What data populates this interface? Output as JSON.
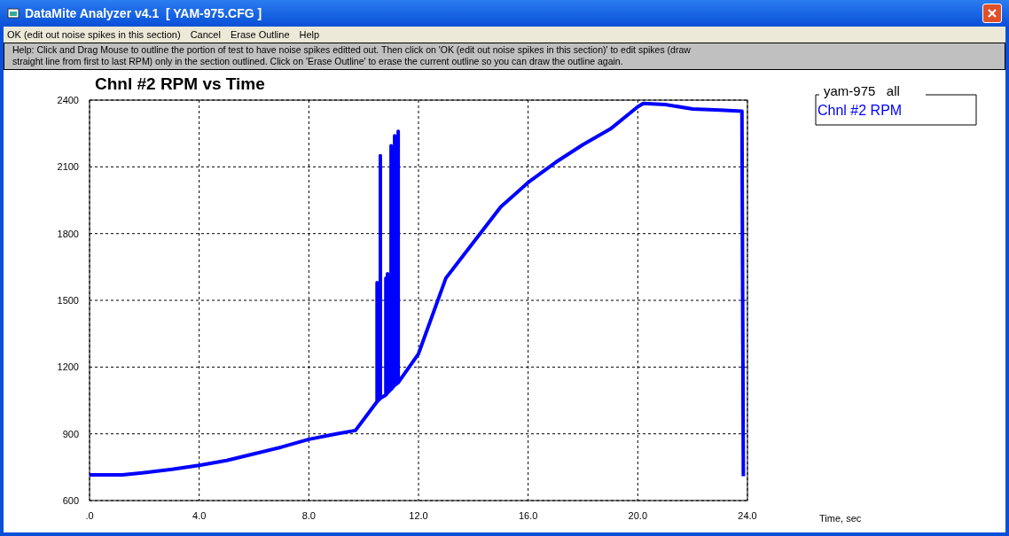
{
  "window": {
    "title": "DataMite Analyzer v4.1  [ YAM-975.CFG ]"
  },
  "menu": [
    "OK (edit out noise spikes in this section)",
    "Cancel",
    "Erase Outline",
    "Help"
  ],
  "help_text": "Help:  Click and Drag Mouse to outline the portion of test to have noise spikes editted out.  Then click on 'OK (edit out noise spikes in this section)' to edit spikes (draw straight line from first to last RPM) only in the section outlined.  Click on 'Erase Outline' to erase the current outline so you can draw the outline again.",
  "legend": {
    "title": "yam-975   all"
  },
  "chart_data": {
    "type": "line",
    "title": "Chnl #2 RPM vs Time",
    "grid": true,
    "x": [
      0,
      1.2,
      2,
      3,
      4,
      5,
      6,
      7,
      8,
      9,
      9.7,
      10.49,
      10.49,
      10.49,
      10.61,
      10.61,
      10.61,
      10.81,
      10.81,
      10.81,
      10.87,
      10.87,
      10.87,
      11.0,
      11.0,
      11.0,
      11.07,
      11.07,
      11.07,
      11.13,
      11.13,
      11.13,
      11.26,
      11.26,
      11.26,
      12,
      13,
      14,
      15,
      16,
      17,
      18,
      19,
      20,
      20.2,
      21,
      22,
      23,
      23.8,
      23.85
    ],
    "series": [
      {
        "name": "Chnl #2 RPM",
        "color": "#0000ff",
        "values": [
          715,
          715,
          725,
          740,
          758,
          780,
          810,
          840,
          875,
          900,
          915,
          1045,
          1580,
          1045,
          1060,
          2150,
          1060,
          1075,
          1600,
          1075,
          1085,
          1620,
          1085,
          1100,
          2195,
          1100,
          1110,
          1660,
          1110,
          1118,
          2240,
          1118,
          1130,
          2260,
          1130,
          1260,
          1600,
          1760,
          1920,
          2030,
          2120,
          2200,
          2270,
          2370,
          2385,
          2380,
          2360,
          2355,
          2350,
          710
        ]
      }
    ],
    "xlim": [
      0,
      24
    ],
    "ylim": [
      600,
      2400
    ],
    "xticks": [
      {
        "value": 0,
        "label": ".0"
      },
      {
        "value": 4,
        "label": "4.0"
      },
      {
        "value": 8,
        "label": "8.0"
      },
      {
        "value": 12,
        "label": "12.0"
      },
      {
        "value": 16,
        "label": "16.0"
      },
      {
        "value": 20,
        "label": "20.0"
      },
      {
        "value": 24,
        "label": "24.0"
      }
    ],
    "yticks": [
      600,
      900,
      1200,
      1500,
      1800,
      2100,
      2400
    ],
    "annotations": [
      {
        "text": "Time, sec"
      }
    ]
  }
}
